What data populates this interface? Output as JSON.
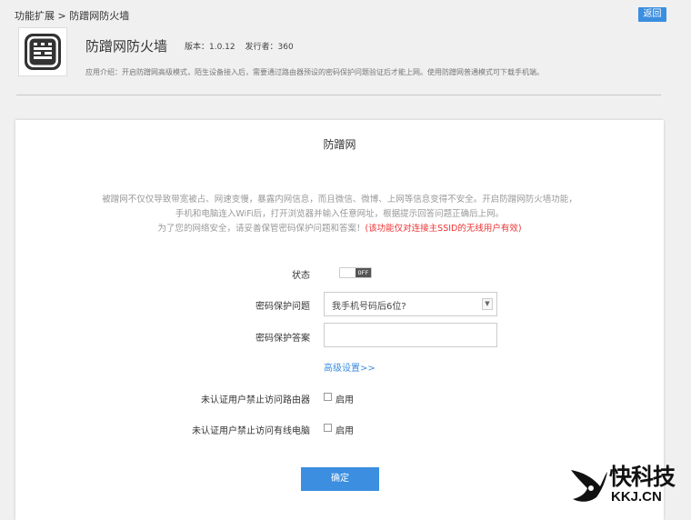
{
  "header": {
    "breadcrumb": "功能扩展 > 防蹭网防火墙",
    "back_label": "返回"
  },
  "app": {
    "name": "防蹭网防火墙",
    "version": "版本：1.0.12",
    "publisher": "发行者：360",
    "description": "应用介绍：开启防蹭网高级模式，陌生设备接入后，需要通过路由器预设的密码保护问题验证后才能上网。使用防蹭网普通模式可下载手机端。"
  },
  "panel": {
    "title": "防蹭网",
    "intro_line1": "被蹭网不仅仅导致带宽被占、网速变慢，暴露内网信息，而且微信、微博、上网等信息变得不安全。开启防蹭网防火墙功能，",
    "intro_line2": "手机和电脑连入WiFi后，打开浏览器并输入任意网址，根据提示回答问题正确后上网。",
    "intro_line3": "为了您的网络安全，请妥善保管密码保护问题和答案！",
    "intro_warning": "(该功能仅对连接主SSID的无线用户有效)"
  },
  "form": {
    "status_label": "状态",
    "status_value": "OFF",
    "question_label": "密码保护问题",
    "question_value": "我手机号码后6位?",
    "answer_label": "密码保护答案",
    "answer_value": "",
    "advanced_label": "高级设置>>",
    "block_router_label": "未认证用户禁止访问路由器",
    "block_router_enable": "启用",
    "block_router_checked": false,
    "block_pc_label": "未认证用户禁止访问有线电脑",
    "block_pc_enable": "启用",
    "block_pc_checked": false,
    "confirm_label": "确定"
  },
  "watermark": {
    "cn": "快科技",
    "en": "KKJ.CN"
  },
  "colors": {
    "accent": "#3b8ee0",
    "warning": "#ee3333",
    "background": "#f0f0f0"
  },
  "icons": {
    "app_logo": "castle-wall-icon",
    "select_arrow": "chevron-down-icon",
    "watermark_logo": "bird-logo-icon"
  }
}
